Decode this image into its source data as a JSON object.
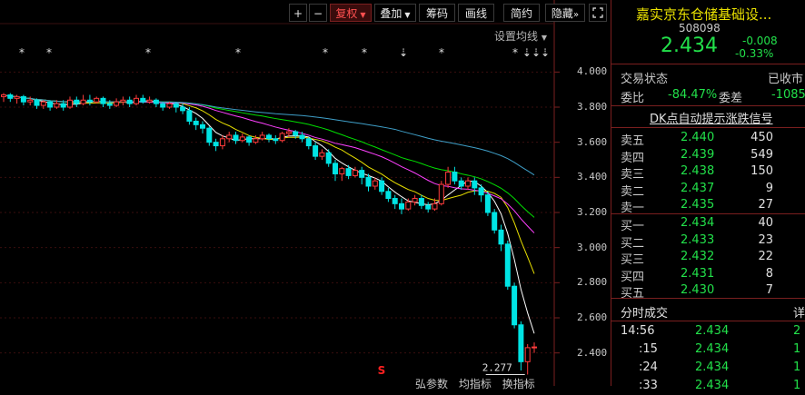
{
  "toolbar": {
    "plus": "+",
    "minus": "−",
    "fuquan": "复权",
    "diejia": "叠加",
    "choumа": "筹码",
    "huaxian": "画线",
    "jiancao": "简约",
    "yincang": "隐藏",
    "ma_settings": "设置均线"
  },
  "chart_data": {
    "type": "candlestick",
    "ylim": [
      2.3,
      4.1
    ],
    "y_ticks": [
      "4.000",
      "3.800",
      "3.600",
      "3.400",
      "3.200",
      "3.000",
      "2.800",
      "2.600",
      "2.400"
    ],
    "low_marker": "2.277",
    "candles": [
      [
        3.86,
        3.87,
        3.88,
        3.83
      ],
      [
        3.87,
        3.85,
        3.88,
        3.83
      ],
      [
        3.85,
        3.86,
        3.87,
        3.82
      ],
      [
        3.86,
        3.83,
        3.87,
        3.81
      ],
      [
        3.83,
        3.84,
        3.86,
        3.81
      ],
      [
        3.84,
        3.81,
        3.85,
        3.79
      ],
      [
        3.81,
        3.83,
        3.84,
        3.79
      ],
      [
        3.83,
        3.8,
        3.84,
        3.78
      ],
      [
        3.8,
        3.82,
        3.84,
        3.79
      ],
      [
        3.82,
        3.8,
        3.84,
        3.78
      ],
      [
        3.8,
        3.84,
        3.86,
        3.79
      ],
      [
        3.84,
        3.82,
        3.86,
        3.8
      ],
      [
        3.82,
        3.84,
        3.87,
        3.81
      ],
      [
        3.84,
        3.83,
        3.87,
        3.81
      ],
      [
        3.83,
        3.85,
        3.86,
        3.82
      ],
      [
        3.85,
        3.82,
        3.86,
        3.8
      ],
      [
        3.82,
        3.81,
        3.84,
        3.79
      ],
      [
        3.81,
        3.83,
        3.85,
        3.8
      ],
      [
        3.83,
        3.84,
        3.86,
        3.81
      ],
      [
        3.84,
        3.82,
        3.86,
        3.8
      ],
      [
        3.82,
        3.85,
        3.87,
        3.81
      ],
      [
        3.85,
        3.83,
        3.87,
        3.82
      ],
      [
        3.83,
        3.84,
        3.86,
        3.82
      ],
      [
        3.84,
        3.82,
        3.85,
        3.8
      ],
      [
        3.82,
        3.8,
        3.83,
        3.78
      ],
      [
        3.8,
        3.82,
        3.83,
        3.79
      ],
      [
        3.82,
        3.8,
        3.83,
        3.77
      ],
      [
        3.8,
        3.78,
        3.82,
        3.76
      ],
      [
        3.78,
        3.72,
        3.8,
        3.7
      ],
      [
        3.72,
        3.7,
        3.74,
        3.67
      ],
      [
        3.7,
        3.68,
        3.72,
        3.65
      ],
      [
        3.68,
        3.6,
        3.69,
        3.58
      ],
      [
        3.6,
        3.58,
        3.62,
        3.55
      ],
      [
        3.58,
        3.62,
        3.64,
        3.56
      ],
      [
        3.62,
        3.64,
        3.66,
        3.6
      ],
      [
        3.64,
        3.61,
        3.66,
        3.59
      ],
      [
        3.61,
        3.63,
        3.65,
        3.6
      ],
      [
        3.63,
        3.6,
        3.64,
        3.58
      ],
      [
        3.6,
        3.62,
        3.64,
        3.59
      ],
      [
        3.62,
        3.64,
        3.66,
        3.61
      ],
      [
        3.64,
        3.62,
        3.65,
        3.6
      ],
      [
        3.62,
        3.61,
        3.64,
        3.59
      ],
      [
        3.61,
        3.65,
        3.66,
        3.6
      ],
      [
        3.65,
        3.66,
        3.68,
        3.63
      ],
      [
        3.66,
        3.64,
        3.67,
        3.62
      ],
      [
        3.64,
        3.62,
        3.66,
        3.6
      ],
      [
        3.62,
        3.58,
        3.63,
        3.56
      ],
      [
        3.58,
        3.52,
        3.6,
        3.5
      ],
      [
        3.52,
        3.54,
        3.56,
        3.5
      ],
      [
        3.54,
        3.48,
        3.56,
        3.46
      ],
      [
        3.48,
        3.42,
        3.5,
        3.38
      ],
      [
        3.42,
        3.45,
        3.46,
        3.38
      ],
      [
        3.45,
        3.41,
        3.47,
        3.39
      ],
      [
        3.41,
        3.44,
        3.46,
        3.4
      ],
      [
        3.44,
        3.4,
        3.46,
        3.36
      ],
      [
        3.4,
        3.35,
        3.42,
        3.32
      ],
      [
        3.35,
        3.38,
        3.4,
        3.33
      ],
      [
        3.38,
        3.32,
        3.4,
        3.3
      ],
      [
        3.32,
        3.28,
        3.34,
        3.26
      ],
      [
        3.28,
        3.25,
        3.3,
        3.22
      ],
      [
        3.25,
        3.22,
        3.28,
        3.19
      ],
      [
        3.22,
        3.26,
        3.28,
        3.21
      ],
      [
        3.26,
        3.28,
        3.3,
        3.24
      ],
      [
        3.28,
        3.24,
        3.3,
        3.22
      ],
      [
        3.24,
        3.22,
        3.26,
        3.2
      ],
      [
        3.22,
        3.25,
        3.28,
        3.21
      ],
      [
        3.25,
        3.36,
        3.38,
        3.24
      ],
      [
        3.36,
        3.43,
        3.46,
        3.34
      ],
      [
        3.43,
        3.38,
        3.46,
        3.36
      ],
      [
        3.38,
        3.35,
        3.4,
        3.33
      ],
      [
        3.35,
        3.38,
        3.4,
        3.33
      ],
      [
        3.38,
        3.34,
        3.4,
        3.3
      ],
      [
        3.34,
        3.3,
        3.36,
        3.26
      ],
      [
        3.3,
        3.2,
        3.32,
        3.18
      ],
      [
        3.2,
        3.1,
        3.22,
        3.08
      ],
      [
        3.1,
        3.02,
        3.13,
        2.98
      ],
      [
        3.02,
        2.78,
        3.04,
        2.76
      ],
      [
        2.78,
        2.56,
        2.8,
        2.54
      ],
      [
        2.56,
        2.35,
        2.58,
        2.3
      ],
      [
        2.35,
        2.43,
        2.45,
        2.277
      ],
      [
        2.43,
        2.434,
        2.46,
        2.4
      ]
    ]
  },
  "signals": {
    "top_marker": "*",
    "up_marker": "⇣",
    "triple": "⇣⇣⇣",
    "buy_signal": "S"
  },
  "bottom_labels": {
    "a": "弘参数",
    "b": "均指标",
    "c": "换指标"
  },
  "quote": {
    "name": "嘉实京东仓储基础设...",
    "code": "508098",
    "price": "2.434",
    "change": "-0.008",
    "change_pct": "-0.33%",
    "status_label": "交易状态",
    "status_value": "已收市",
    "weibi_label": "委比",
    "weibi_value": "-84.47%",
    "weicha_label": "委差",
    "weicha_value": "-1085",
    "dk_link": "DK点自动提示涨跌信号"
  },
  "order_book": {
    "asks": [
      {
        "label": "卖五",
        "price": "2.440",
        "vol": "450"
      },
      {
        "label": "卖四",
        "price": "2.439",
        "vol": "549"
      },
      {
        "label": "卖三",
        "price": "2.438",
        "vol": "150"
      },
      {
        "label": "卖二",
        "price": "2.437",
        "vol": "9"
      },
      {
        "label": "卖一",
        "price": "2.435",
        "vol": "27"
      }
    ],
    "bids": [
      {
        "label": "买一",
        "price": "2.434",
        "vol": "40"
      },
      {
        "label": "买二",
        "price": "2.433",
        "vol": "23"
      },
      {
        "label": "买三",
        "price": "2.432",
        "vol": "22"
      },
      {
        "label": "买四",
        "price": "2.431",
        "vol": "8"
      },
      {
        "label": "买五",
        "price": "2.430",
        "vol": "7"
      }
    ]
  },
  "trades": {
    "title": "分时成交",
    "detail": "详",
    "rows": [
      {
        "time": "14:56",
        "price": "2.434",
        "vol": "2"
      },
      {
        "time": ":15",
        "price": "2.434",
        "vol": "1"
      },
      {
        "time": ":24",
        "price": "2.434",
        "vol": "1"
      },
      {
        "time": ":33",
        "price": "2.434",
        "vol": "1"
      }
    ]
  },
  "colors": {
    "up": "#ff3b3b",
    "down": "#00e4e4",
    "ma5": "#ffffff",
    "ma10": "#e8e000",
    "ma20": "#ff40ff",
    "ma30": "#00e000",
    "ma60": "#3f9fc8"
  }
}
